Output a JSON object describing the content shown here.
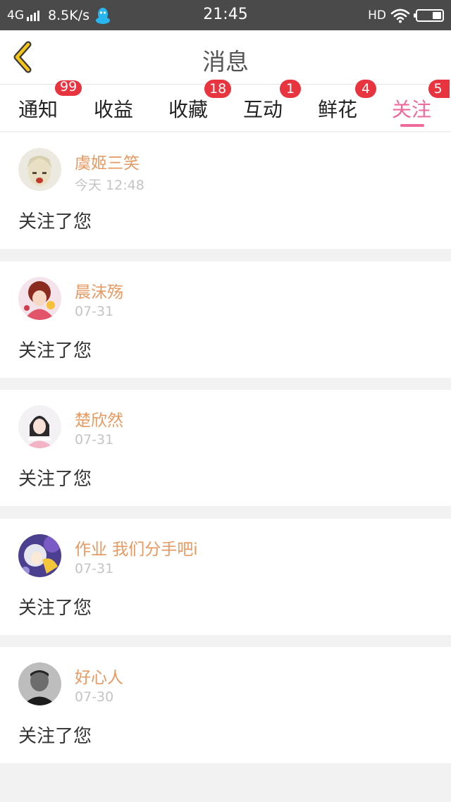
{
  "status_bar": {
    "network": "4G",
    "speed": "8.5K/s",
    "time": "21:45",
    "hd": "HD"
  },
  "header": {
    "title": "消息"
  },
  "tabs": [
    {
      "label": "通知",
      "badge": "99"
    },
    {
      "label": "收益",
      "badge": ""
    },
    {
      "label": "收藏",
      "badge": "18"
    },
    {
      "label": "互动",
      "badge": "1"
    },
    {
      "label": "鲜花",
      "badge": "4"
    },
    {
      "label": "关注",
      "badge": "5",
      "active": true
    }
  ],
  "messages": [
    {
      "user": "虞姬三笑",
      "time": "今天 12:48",
      "text": "关注了您"
    },
    {
      "user": "晨沫殇",
      "time": "07-31",
      "text": "关注了您"
    },
    {
      "user": "楚欣然",
      "time": "07-31",
      "text": "关注了您"
    },
    {
      "user": "作业 我们分手吧i",
      "time": "07-31",
      "text": "关注了您"
    },
    {
      "user": "好心人",
      "time": "07-30",
      "text": "关注了您"
    }
  ],
  "colors": {
    "accent": "#ee6a9b",
    "username": "#e69a63",
    "badge": "#e8343f",
    "back_arrow": "#f5c518"
  },
  "icons": [
    "signal-icon",
    "qq-penguin-icon",
    "wifi-icon",
    "battery-icon",
    "back-arrow-icon"
  ]
}
